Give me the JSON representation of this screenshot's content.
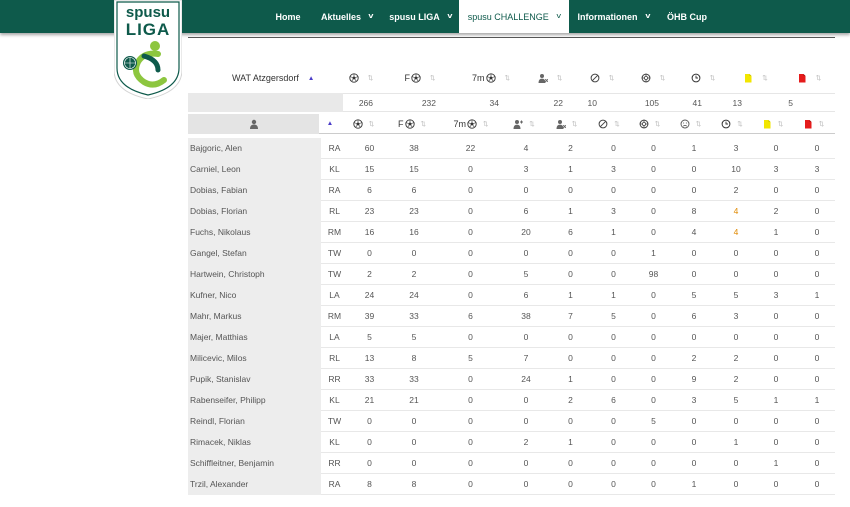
{
  "nav": {
    "items": [
      {
        "label": "Home",
        "dropdown": false,
        "active": false,
        "width": 48
      },
      {
        "label": "Aktuelles",
        "dropdown": true,
        "active": false,
        "width": 70
      },
      {
        "label": "spusu LIGA",
        "dropdown": true,
        "active": false,
        "width": 77
      },
      {
        "label": "spusu CHALLENGE",
        "dropdown": true,
        "active": true,
        "width": 110
      },
      {
        "label": "Informationen",
        "dropdown": true,
        "active": false,
        "width": 89
      },
      {
        "label": "ÖHB Cup",
        "dropdown": false,
        "active": false,
        "width": 58
      }
    ]
  },
  "logo": {
    "line1": "spusu",
    "line2": "LIGA"
  },
  "team": {
    "name": "WAT Atzgersdorf",
    "header_labels": {
      "goals": "",
      "field_goals": "F",
      "seven_m": "7m",
      "exclusions": "",
      "red_cards": "",
      "saves": "",
      "two_min": "",
      "yellow": "",
      "red": ""
    },
    "totals": {
      "goals": "266",
      "field_goals": "232",
      "seven_m": "34",
      "exclusions": "22",
      "red_cards": "10",
      "saves": "105",
      "two_min": "41",
      "yellow": "13",
      "red": "5"
    }
  },
  "player_table": {
    "headers": [
      "",
      "F",
      "7m",
      "",
      "",
      "",
      "",
      "",
      "",
      "",
      ""
    ],
    "rows": [
      {
        "name": "Bajgoric, Alen",
        "pos": "RA",
        "vals": [
          "60",
          "38",
          "22",
          "4",
          "2",
          "0",
          "0",
          "1",
          "3",
          "0",
          "0"
        ]
      },
      {
        "name": "Carniel, Leon",
        "pos": "KL",
        "vals": [
          "15",
          "15",
          "0",
          "3",
          "1",
          "3",
          "0",
          "0",
          "10",
          "3",
          "3"
        ]
      },
      {
        "name": "Dobias, Fabian",
        "pos": "RA",
        "vals": [
          "6",
          "6",
          "0",
          "0",
          "0",
          "0",
          "0",
          "0",
          "2",
          "0",
          "0"
        ]
      },
      {
        "name": "Dobias, Florian",
        "pos": "RL",
        "vals": [
          "23",
          "23",
          "0",
          "6",
          "1",
          "3",
          "0",
          "8",
          "4",
          "2",
          "0"
        ]
      },
      {
        "name": "Fuchs, Nikolaus",
        "pos": "RM",
        "vals": [
          "16",
          "16",
          "0",
          "20",
          "6",
          "1",
          "0",
          "4",
          "4",
          "1",
          "0"
        ]
      },
      {
        "name": "Gangel, Stefan",
        "pos": "TW",
        "vals": [
          "0",
          "0",
          "0",
          "0",
          "0",
          "0",
          "1",
          "0",
          "0",
          "0",
          "0"
        ]
      },
      {
        "name": "Hartwein, Christoph",
        "pos": "TW",
        "vals": [
          "2",
          "2",
          "0",
          "5",
          "0",
          "0",
          "98",
          "0",
          "0",
          "0",
          "0"
        ]
      },
      {
        "name": "Kufner, Nico",
        "pos": "LA",
        "vals": [
          "24",
          "24",
          "0",
          "6",
          "1",
          "1",
          "0",
          "5",
          "5",
          "3",
          "1"
        ]
      },
      {
        "name": "Mahr, Markus",
        "pos": "RM",
        "vals": [
          "39",
          "33",
          "6",
          "38",
          "7",
          "5",
          "0",
          "6",
          "3",
          "0",
          "0"
        ]
      },
      {
        "name": "Majer, Matthias",
        "pos": "LA",
        "vals": [
          "5",
          "5",
          "0",
          "0",
          "0",
          "0",
          "0",
          "0",
          "0",
          "0",
          "0"
        ]
      },
      {
        "name": "Milicevic, Milos",
        "pos": "RL",
        "vals": [
          "13",
          "8",
          "5",
          "7",
          "0",
          "0",
          "0",
          "2",
          "2",
          "0",
          "0"
        ]
      },
      {
        "name": "Pupik, Stanislav",
        "pos": "RR",
        "vals": [
          "33",
          "33",
          "0",
          "24",
          "1",
          "0",
          "0",
          "9",
          "2",
          "0",
          "0"
        ]
      },
      {
        "name": "Rabenseifer, Philipp",
        "pos": "KL",
        "vals": [
          "21",
          "21",
          "0",
          "0",
          "2",
          "6",
          "0",
          "3",
          "5",
          "1",
          "1"
        ]
      },
      {
        "name": "Reindl, Florian",
        "pos": "TW",
        "vals": [
          "0",
          "0",
          "0",
          "0",
          "0",
          "0",
          "5",
          "0",
          "0",
          "0",
          "0"
        ]
      },
      {
        "name": "Rimacek, Niklas",
        "pos": "KL",
        "vals": [
          "0",
          "0",
          "0",
          "2",
          "1",
          "0",
          "0",
          "0",
          "1",
          "0",
          "0"
        ]
      },
      {
        "name": "Schiffleitner, Benjamin",
        "pos": "RR",
        "vals": [
          "0",
          "0",
          "0",
          "0",
          "0",
          "0",
          "0",
          "0",
          "0",
          "1",
          "0"
        ]
      },
      {
        "name": "Trzil, Alexander",
        "pos": "RA",
        "vals": [
          "8",
          "8",
          "0",
          "0",
          "0",
          "0",
          "0",
          "1",
          "0",
          "0",
          "0"
        ]
      }
    ]
  },
  "colors": {
    "brand_green": "#0e5a4b",
    "logo_lime": "#8dc63f",
    "highlight_orange": "#e08a00",
    "yellow_card": "#f2e600",
    "red_card": "#e51b1b",
    "sort_active": "#4a3cc8"
  },
  "icons": {
    "goals": "ball-icon",
    "field_goals": "ball-icon",
    "seven_m": "ball-icon",
    "assists": "user-plus-icon",
    "exclusions": "user-x-icon",
    "red_cards": "ban-icon",
    "saves": "crosshair-icon",
    "sad": "sad-face-icon",
    "two_min": "clock-icon",
    "yellow": "yellow-card-icon",
    "red": "red-card-icon",
    "player": "user-icon"
  }
}
